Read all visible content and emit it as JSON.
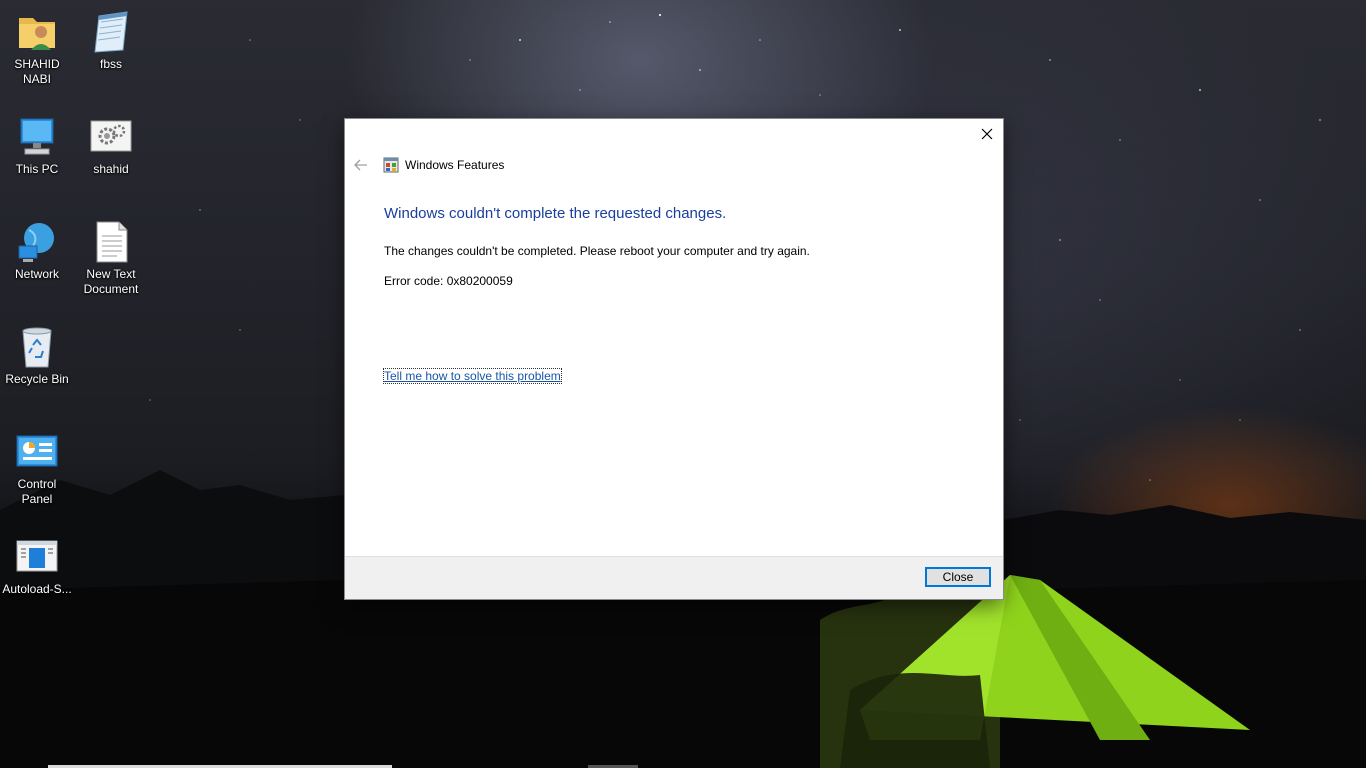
{
  "desktop": {
    "icons": [
      {
        "label": "SHAHID NABI",
        "icon": "user-folder-icon"
      },
      {
        "label": "fbss",
        "icon": "notepad-icon"
      },
      {
        "label": "This PC",
        "icon": "computer-icon"
      },
      {
        "label": "shahid",
        "icon": "settings-file-icon"
      },
      {
        "label": "Network",
        "icon": "network-icon"
      },
      {
        "label": "New Text Document",
        "icon": "text-document-icon"
      },
      {
        "label": "Recycle Bin",
        "icon": "recycle-bin-icon"
      },
      {
        "label": "Control Panel",
        "icon": "control-panel-icon"
      },
      {
        "label": "Autoload-S...",
        "icon": "autoload-app-icon"
      }
    ]
  },
  "dialog": {
    "title": "Windows Features",
    "heading": "Windows couldn't complete the requested changes.",
    "message": "The changes couldn't be completed. Please reboot your computer and try again.",
    "error_code": "Error code: 0x80200059",
    "help_link": "Tell me how to solve this problem",
    "close_button": "Close"
  },
  "colors": {
    "heading": "#1a3e9e",
    "link": "#1a56a8",
    "button_border": "#0078d7",
    "footer": "#f0f0f0"
  }
}
